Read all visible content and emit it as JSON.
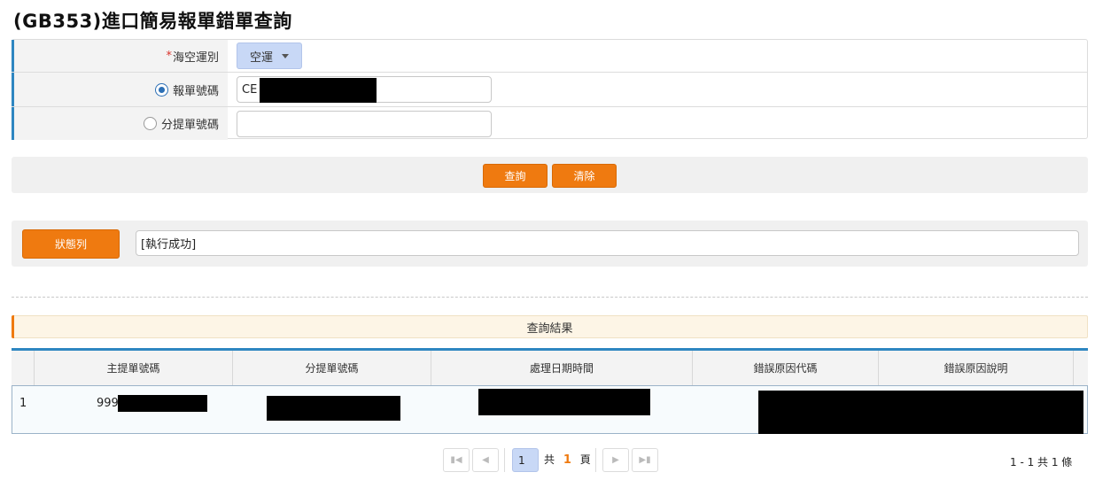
{
  "page_title": "(GB353)進口簡易報單錯單查詢",
  "form": {
    "transport": {
      "required_mark": "*",
      "label": "海空運別",
      "value": "空運"
    },
    "declaration_no": {
      "label": "報單號碼",
      "value": "CE",
      "selected": true
    },
    "sub_bill_no": {
      "label": "分提單號碼",
      "value": "",
      "selected": false
    }
  },
  "actions": {
    "query_label": "查詢",
    "clear_label": "清除"
  },
  "status": {
    "button_label": "狀態列",
    "message": "[執行成功]"
  },
  "results": {
    "title": "查詢結果",
    "columns": [
      "主提單號碼",
      "分提單號碼",
      "處理日期時間",
      "錯誤原因代碼",
      "錯誤原因說明"
    ],
    "rows": [
      {
        "index": "1",
        "master_bill_prefix": "999"
      }
    ]
  },
  "pager": {
    "page_value": "1",
    "total_prefix": "共",
    "total_pages": "1",
    "total_suffix": "頁",
    "summary": "1 - 1 共 1 條"
  },
  "colors": {
    "accent_orange": "#ef7a10",
    "accent_blue": "#2e86c1"
  }
}
